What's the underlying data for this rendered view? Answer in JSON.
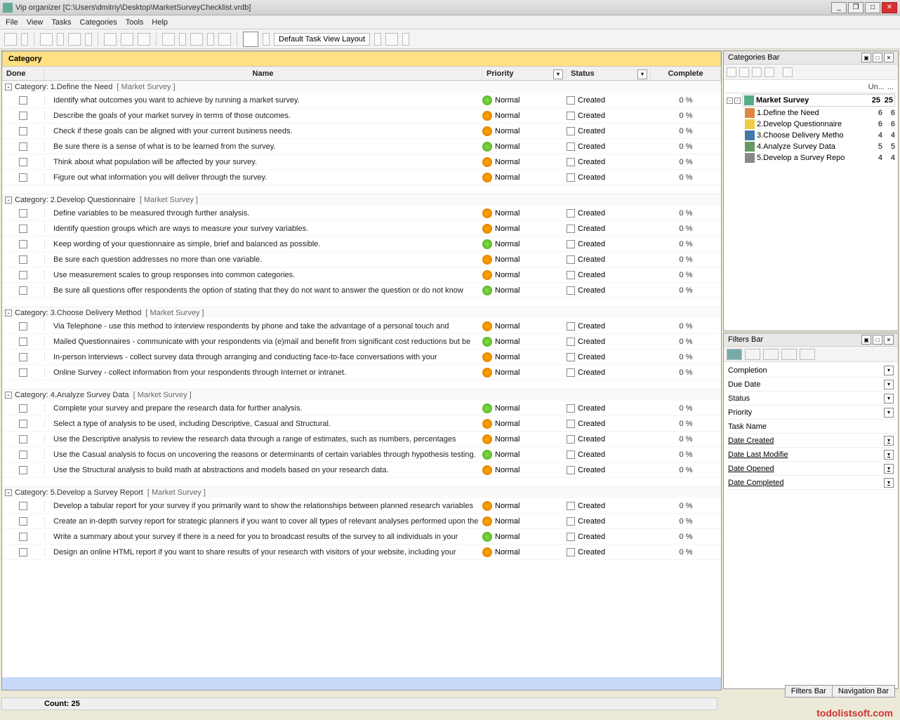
{
  "window": {
    "title": "Vip organizer [C:\\Users\\dmitriy\\Desktop\\MarketSurveyChecklist.vrdb]"
  },
  "menu": [
    "File",
    "View",
    "Tasks",
    "Categories",
    "Tools",
    "Help"
  ],
  "toolbar": {
    "layout_label": "Default Task View Layout"
  },
  "columns": {
    "done": "Done",
    "name": "Name",
    "priority": "Priority",
    "status": "Status",
    "complete": "Complete"
  },
  "category_header": "Category",
  "defaults": {
    "priority": "Normal",
    "status": "Created",
    "complete": "0 %"
  },
  "groups": [
    {
      "index": "1",
      "title": "Define the Need",
      "survey": "[ Market Survey ]",
      "tasks": [
        "Identify what outcomes you want to achieve by running a market survey.",
        "Describe the goals of your market survey in terms of those outcomes.",
        "Check if these goals can be aligned with your current business needs.",
        "Be sure there is a sense of what is to be learned from the survey.",
        "Think about what population will be affected by your survey.",
        "Figure out what information you will deliver through the survey."
      ]
    },
    {
      "index": "2",
      "title": "Develop Questionnaire",
      "survey": "[ Market Survey ]",
      "tasks": [
        "Define variables to be measured through further analysis.",
        "Identify question groups which are ways to measure your survey variables.",
        "Keep wording of your questionnaire as simple, brief and balanced as possible.",
        "Be sure each question addresses no more than one variable.",
        "Use measurement scales to group responses into common categories.",
        "Be sure all questions offer respondents the option of stating that they do not want to answer the question or do not know"
      ]
    },
    {
      "index": "3",
      "title": "Choose Delivery Method",
      "survey": "[ Market Survey ]",
      "tasks": [
        "Via Telephone - use this method to interview respondents by phone and take the advantage of a personal touch and",
        "Mailed Questionnaires - communicate with your respondents via (e)mail and benefit from significant cost reductions but be",
        "In-person Interviews - collect survey data through arranging and conducting face-to-face conversations with your",
        "Online Survey - collect information from your respondents through Internet or intranet."
      ]
    },
    {
      "index": "4",
      "title": "Analyze Survey Data",
      "survey": "[ Market Survey ]",
      "tasks": [
        "Complete your survey and prepare the research data for further analysis.",
        "Select a type of analysis to be used, including Descriptive, Casual and Structural.",
        "Use the Descriptive analysis to review the research data through a range of estimates, such as numbers, percentages",
        "Use the Casual analysis to focus on uncovering the reasons or determinants of certain variables through hypothesis testing.",
        "Use the Structural analysis to build math at abstractions and models based on your research data."
      ]
    },
    {
      "index": "5",
      "title": "Develop a Survey Report",
      "survey": "[ Market Survey ]",
      "tasks": [
        "Develop a tabular report for your survey if you primarily want to show the relationships between planned research variables",
        "Create an in-depth survey report for strategic planners if you want to cover all types of relevant analyses performed upon the",
        "Write a summary about your survey if there is a need for you to broadcast results of the survey to all individuals in your",
        "Design an online HTML report if you want to share results of your research with visitors of your website, including your"
      ]
    }
  ],
  "categories_panel": {
    "title": "Categories Bar",
    "head_label": "Un...",
    "root": {
      "label": "Market Survey",
      "a": "25",
      "b": "25"
    },
    "items": [
      {
        "label": "1.Define the Need",
        "a": "6",
        "b": "6",
        "cls": "ti-1"
      },
      {
        "label": "2.Develop Questionnaire",
        "a": "6",
        "b": "6",
        "cls": "ti-2"
      },
      {
        "label": "3.Choose Delivery Metho",
        "a": "4",
        "b": "4",
        "cls": "ti-3"
      },
      {
        "label": "4.Analyze Survey Data",
        "a": "5",
        "b": "5",
        "cls": "ti-4"
      },
      {
        "label": "5.Develop a Survey Repo",
        "a": "4",
        "b": "4",
        "cls": "ti-5"
      }
    ]
  },
  "filters_panel": {
    "title": "Filters Bar",
    "items": [
      {
        "label": "Completion",
        "u": false,
        "drop": true
      },
      {
        "label": "Due Date",
        "u": false,
        "drop": true
      },
      {
        "label": "Status",
        "u": false,
        "drop": true
      },
      {
        "label": "Priority",
        "u": false,
        "drop": true
      },
      {
        "label": "Task Name",
        "u": false,
        "drop": false
      },
      {
        "label": "Date Created",
        "u": true,
        "drop": true
      },
      {
        "label": "Date Last Modifie",
        "u": true,
        "drop": true
      },
      {
        "label": "Date Opened",
        "u": true,
        "drop": true
      },
      {
        "label": "Date Completed",
        "u": true,
        "drop": true
      }
    ]
  },
  "bottom_tabs": [
    "Filters Bar",
    "Navigation Bar"
  ],
  "status": {
    "count_label": "Count: 25"
  },
  "watermark": "todolistsoft.com",
  "category_prefix": "Category:"
}
